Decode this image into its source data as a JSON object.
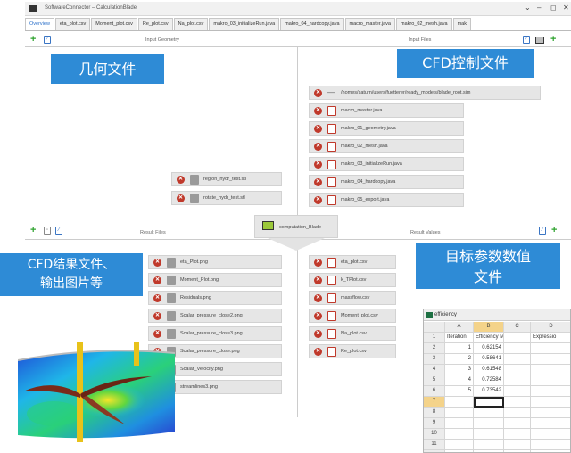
{
  "window": {
    "title": "SoftwareConnector – CalculationBlade"
  },
  "tabs": [
    {
      "label": "Overview",
      "active": true
    },
    {
      "label": "eta_plot.csv"
    },
    {
      "label": "Moment_plot.csv"
    },
    {
      "label": "Re_plot.csv"
    },
    {
      "label": "Na_plot.csv"
    },
    {
      "label": "makro_03_initializeRun.java"
    },
    {
      "label": "makro_04_hardcopy.java"
    },
    {
      "label": "macro_master.java"
    },
    {
      "label": "makro_02_mesh.java"
    },
    {
      "label": "mak"
    }
  ],
  "sections": {
    "input_geometry": "Input Geometry",
    "input_files": "Input Files",
    "result_files": "Result Files",
    "result_values": "Result Values"
  },
  "geometry_files": [
    "region_hydr_test.stl",
    "rotate_hydr_test.stl"
  ],
  "input_files": [
    {
      "name": "/homes/saturn/users/fuetterer/ready_models/blade_root.sim",
      "icon": "dash"
    },
    {
      "name": "macro_master.java",
      "icon": "file"
    },
    {
      "name": "makro_01_geometry.java",
      "icon": "file"
    },
    {
      "name": "makro_02_mesh.java",
      "icon": "file"
    },
    {
      "name": "makro_03_initializeRun.java",
      "icon": "file"
    },
    {
      "name": "makro_04_hardcopy.java",
      "icon": "file"
    },
    {
      "name": "makro_05_export.java",
      "icon": "file"
    }
  ],
  "computation": {
    "label": "computation_Blade"
  },
  "result_files": [
    "eta_Plot.png",
    "Moment_Plot.png",
    "Residuals.png",
    "Scalar_pressure_close2.png",
    "Scalar_pressure_close3.png",
    "Scalar_pressure_close.png",
    "Scalar_Velocity.png",
    "streamlines3.png"
  ],
  "result_values": [
    "eta_plot.csv",
    "k_TPlot.csv",
    "massflow.csv",
    "Moment_plot.csv",
    "Na_plot.csv",
    "Re_plot.csv"
  ],
  "callouts": {
    "geometry": "几何文件",
    "cfd_control": "CFD控制文件",
    "results": "CFD结果文件、\n输出图片等",
    "target": "目标参数数值\n文件"
  },
  "spreadsheet": {
    "title": "efficiency",
    "columns": [
      "A",
      "B",
      "C",
      "D"
    ],
    "rows": [
      [
        "Iteration",
        "Efficiency Monitor: Efficiency Monitor",
        "",
        "Expressio"
      ],
      [
        "1",
        "0.62154",
        "",
        ""
      ],
      [
        "2",
        "0.58641",
        "",
        ""
      ],
      [
        "3",
        "0.61548",
        "",
        ""
      ],
      [
        "4",
        "0.72584",
        "",
        ""
      ],
      [
        "5",
        "0.73542",
        "",
        ""
      ],
      [
        "",
        "",
        "",
        ""
      ],
      [
        "",
        "",
        "",
        ""
      ],
      [
        "",
        "",
        "",
        ""
      ],
      [
        "",
        "",
        "",
        ""
      ],
      [
        "",
        "",
        "",
        ""
      ],
      [
        "",
        "",
        "",
        ""
      ]
    ]
  },
  "colors": {
    "callout": "#2e8bd6",
    "delete": "#c0392b",
    "add": "#2fa32f",
    "link": "#2a6fc9"
  }
}
